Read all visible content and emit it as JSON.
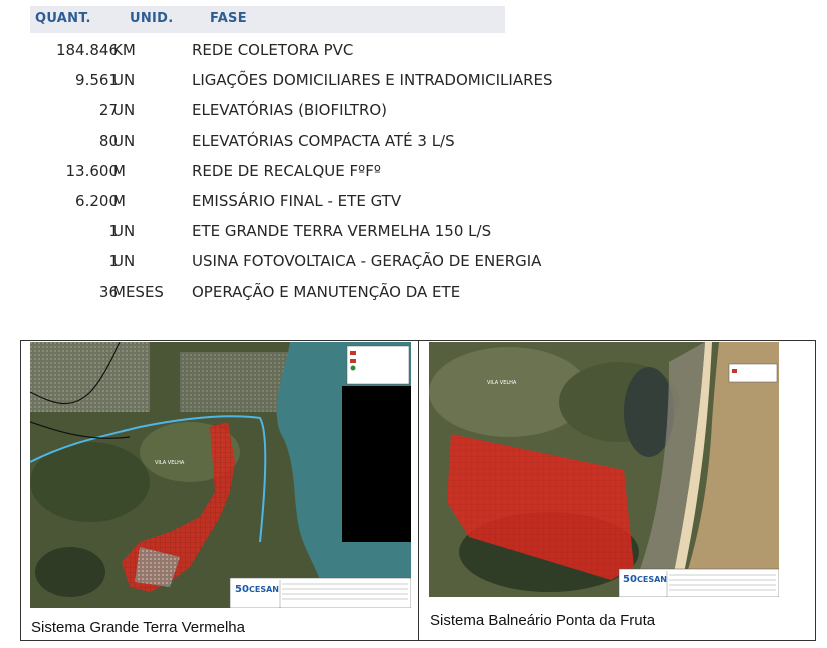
{
  "table": {
    "headers": {
      "quant": "QUANT.",
      "unid": "UNID.",
      "fase": "FASE"
    },
    "rows": [
      {
        "quant": "184.846",
        "unid": "KM",
        "fase": "REDE COLETORA PVC"
      },
      {
        "quant": "9.561",
        "unid": "UN",
        "fase": "LIGAÇÕES DOMICILIARES E INTRADOMICILIARES"
      },
      {
        "quant": "27",
        "unid": "UN",
        "fase": "ELEVATÓRIAS (BIOFILTRO)"
      },
      {
        "quant": "80",
        "unid": "UN",
        "fase": "ELEVATÓRIAS COMPACTA ATÉ 3 L/S"
      },
      {
        "quant": "13.600",
        "unid": "M",
        "fase": "REDE DE RECALQUE FºFº"
      },
      {
        "quant": "6.200",
        "unid": "M",
        "fase": "EMISSÁRIO FINAL - ETE GTV"
      },
      {
        "quant": "1",
        "unid": "UN",
        "fase": "ETE GRANDE TERRA VERMELHA 150 L/S"
      },
      {
        "quant": "1",
        "unid": "UN",
        "fase": "USINA FOTOVOLTAICA - GERAÇÃO DE ENERGIA"
      },
      {
        "quant": "36",
        "unid": "MESES",
        "fase": "OPERAÇÃO E MANUTENÇÃO DA ETE"
      }
    ]
  },
  "maps": [
    {
      "caption": "Sistema Grande Terra Vermelha",
      "logo_text": "CESAN",
      "logo_number": "50",
      "place_label": "VILA VELHA"
    },
    {
      "caption": "Sistema Balneário Ponta da Fruta",
      "logo_text": "CESAN",
      "logo_number": "50",
      "place_label": "VILA VELHA"
    }
  ],
  "colors": {
    "header_bg": "#e9ebf1",
    "header_text": "#2e5d93",
    "area_fill": "#e0281e",
    "water": "#3f7f83",
    "land": "#4d5a3a"
  }
}
